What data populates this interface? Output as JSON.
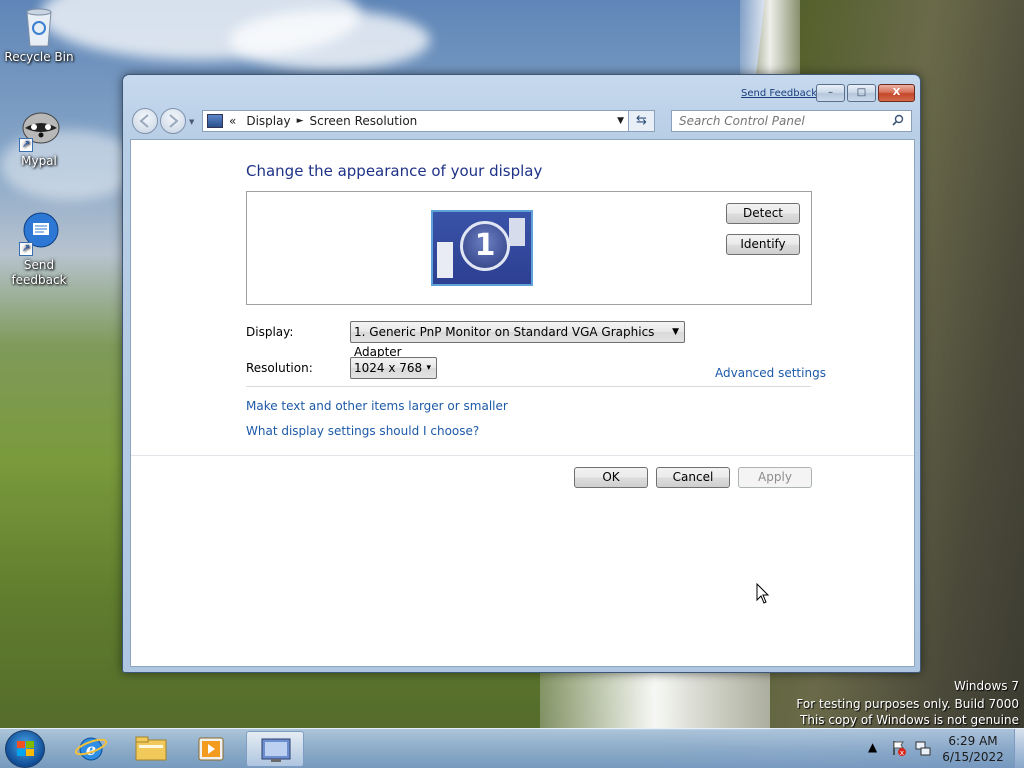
{
  "desktop": {
    "icons": [
      {
        "label": "Recycle Bin",
        "icon": "recycle-bin-icon"
      },
      {
        "label": "Mypal",
        "icon": "mypal-raccoon-icon"
      },
      {
        "label": "Send feedback",
        "icon": "send-feedback-icon"
      }
    ],
    "watermark": {
      "line1": "Windows 7",
      "line2": "For testing purposes only. Build 7000",
      "line3": "This copy of Windows is not genuine"
    }
  },
  "window": {
    "send_feedback": "Send Feedback",
    "caption": {
      "minimize": "–",
      "maximize": "□",
      "close": "X"
    },
    "address": {
      "overflow": "«",
      "crumbs": [
        "Display",
        "Screen Resolution"
      ],
      "separator": "►",
      "dropdown": "▼",
      "refresh": "⇆"
    },
    "search": {
      "placeholder": "Search Control Panel",
      "icon": "search-icon"
    },
    "heading": "Change the appearance of your display",
    "monitor_number": "1",
    "detect_label": "Detect",
    "identify_label": "Identify",
    "display_label": "Display:",
    "display_value": "1. Generic PnP Monitor on Standard VGA Graphics Adapter",
    "resolution_label": "Resolution:",
    "resolution_value": "1024 x 768",
    "advanced_link": "Advanced settings",
    "link_larger": "Make text and other items larger or smaller",
    "link_choose": "What display settings should I choose?",
    "ok_label": "OK",
    "cancel_label": "Cancel",
    "apply_label": "Apply"
  },
  "taskbar": {
    "pinned": [
      "start-orb",
      "internet-explorer-icon",
      "windows-explorer-icon",
      "media-player-icon",
      "screen-resolution-app-icon"
    ],
    "tray_show_hidden": "▲",
    "time": "6:29 AM",
    "date": "6/15/2022"
  },
  "colors": {
    "link": "#1d5aa8",
    "heading": "#1e3287",
    "taskbar": "#91b2d6"
  }
}
